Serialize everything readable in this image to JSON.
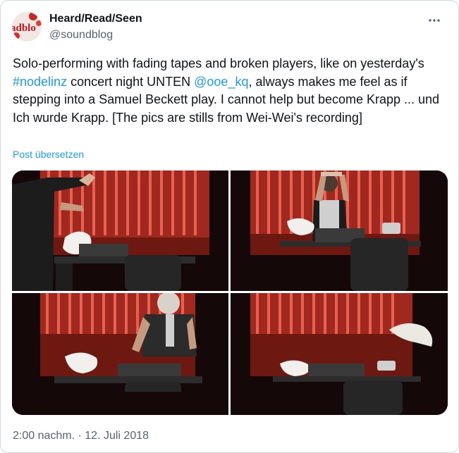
{
  "author": {
    "display_name": "Heard/Read/Seen",
    "handle": "@soundblog",
    "avatar_text": "adblo"
  },
  "tweet": {
    "text_before_tag": "Solo-performing with fading tapes and broken players, like on yesterday's ",
    "hashtag": "#nodelinz",
    "text_mid": " concert night UNTEN ",
    "mention": "@ooe_kq",
    "text_after": ", always makes me feel as if stepping into a Samuel Beckett play. I cannot help but become Krapp ... und Ich wurde Krapp. [The pics are stills from Wei-Wei's recording]",
    "translate_label": "Post übersetzen"
  },
  "media": {
    "photos": [
      {
        "alt": "Performer's arms holding tape strands in front of red curtain"
      },
      {
        "alt": "Performer holding object above head at table with equipment"
      },
      {
        "alt": "Performer bent over table of electronics, wearing suspenders"
      },
      {
        "alt": "Crumpled paper floating at right of table, red curtain backdrop"
      }
    ]
  },
  "meta": {
    "time": "2:00 nachm.",
    "separator": " · ",
    "date": "12. Juli 2018"
  },
  "colors": {
    "link": "#1d9bf0",
    "secondary_text": "#536471",
    "curtain_red": "#c0392b"
  }
}
